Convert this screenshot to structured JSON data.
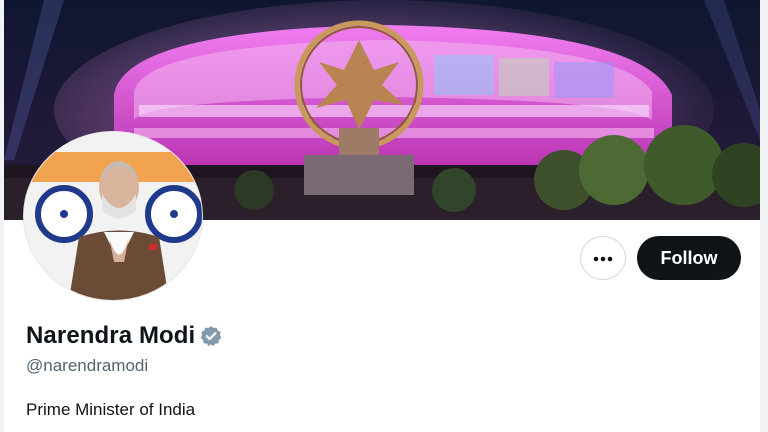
{
  "profile": {
    "display_name": "Narendra Modi",
    "handle": "@narendramodi",
    "bio": "Prime Minister of India",
    "verified": true
  },
  "actions": {
    "more_icon": "more-horizontal-icon",
    "follow_label": "Follow"
  },
  "colors": {
    "follow_bg": "#0f1419",
    "handle_text": "#536471",
    "verified_badge": "#829aab",
    "banner_magenta": "#d23bd0"
  }
}
